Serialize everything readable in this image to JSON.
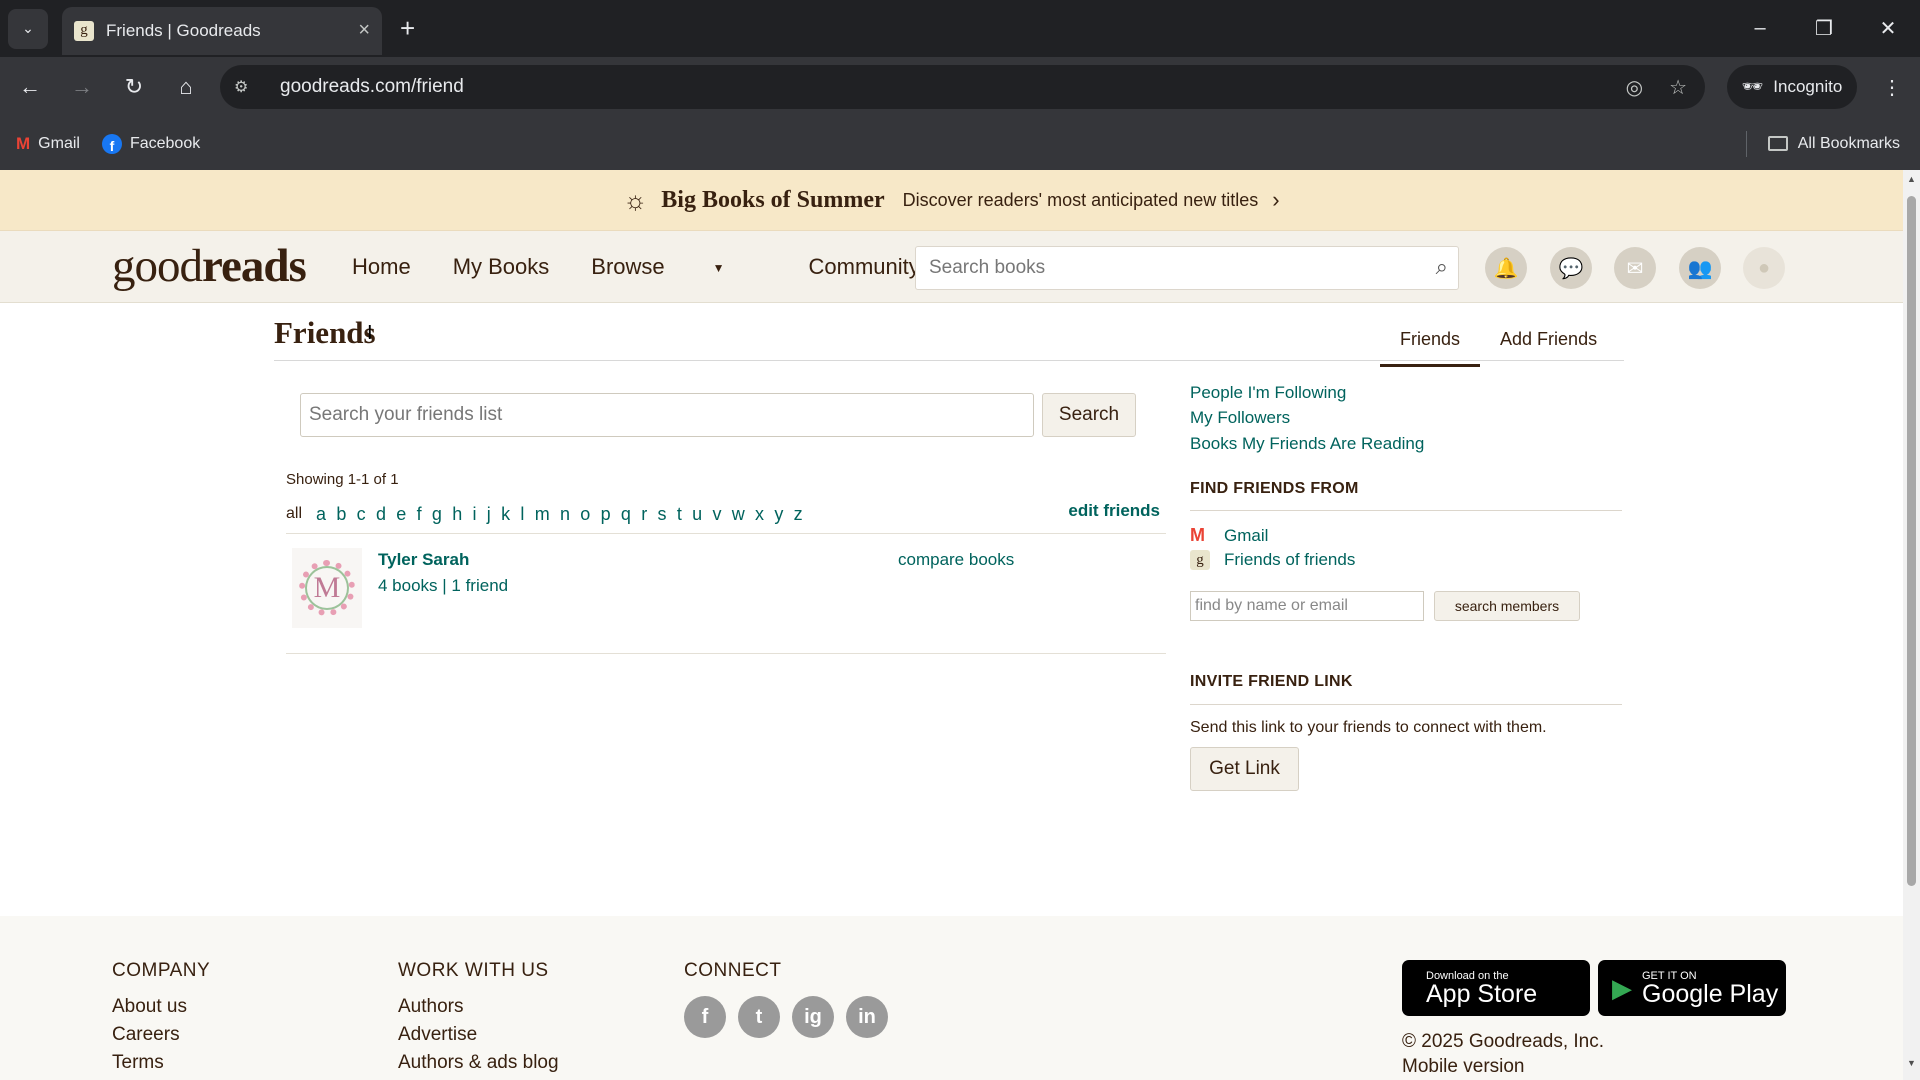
{
  "browser": {
    "tab_title": "Friends | Goodreads",
    "tab_favicon": "g",
    "url": "goodreads.com/friend",
    "incognito_label": "Incognito",
    "bookmarks": [
      {
        "label": "Gmail",
        "icon": "gmail-icon"
      },
      {
        "label": "Facebook",
        "icon": "facebook-icon"
      }
    ],
    "all_bookmarks_label": "All Bookmarks"
  },
  "promo": {
    "title": "Big Books of Summer",
    "text": "Discover readers' most anticipated new titles"
  },
  "header": {
    "logo_light": "good",
    "logo_bold": "reads",
    "nav": [
      "Home",
      "My Books",
      "Browse",
      "Community"
    ],
    "search_placeholder": "Search books"
  },
  "page": {
    "title": "Friends",
    "tabs": [
      "Friends",
      "Add Friends"
    ],
    "search_placeholder": "Search your friends list",
    "search_button": "Search",
    "showing": "Showing 1-1 of 1",
    "letters_all": "all",
    "letters": [
      "a",
      "b",
      "c",
      "d",
      "e",
      "f",
      "g",
      "h",
      "i",
      "j",
      "k",
      "l",
      "m",
      "n",
      "o",
      "p",
      "q",
      "r",
      "s",
      "t",
      "u",
      "v",
      "w",
      "x",
      "y",
      "z"
    ],
    "edit_friends": "edit friends",
    "friends": [
      {
        "name": "Tyler Sarah",
        "meta": "4 books | 1 friend",
        "compare": "compare books",
        "avatar_letter": "M"
      }
    ]
  },
  "sidebar": {
    "links": [
      "People I'm Following",
      "My Followers",
      "Books My Friends Are Reading"
    ],
    "find_heading": "FIND FRIENDS FROM",
    "sources": [
      "Gmail",
      "Friends of friends"
    ],
    "find_placeholder": "find by name or email",
    "find_button": "search members",
    "invite_heading": "INVITE FRIEND LINK",
    "invite_text": "Send this link to your friends to connect with them.",
    "get_link": "Get Link"
  },
  "footer": {
    "company_heading": "COMPANY",
    "company_links": [
      "About us",
      "Careers",
      "Terms"
    ],
    "work_heading": "WORK WITH US",
    "work_links": [
      "Authors",
      "Advertise",
      "Authors & ads blog"
    ],
    "connect_heading": "CONNECT",
    "social": [
      "f",
      "t",
      "ig",
      "in"
    ],
    "app_store_small": "Download on the",
    "app_store_large": "App Store",
    "play_small": "GET IT ON",
    "play_large": "Google Play",
    "copyright": "© 2025 Goodreads, Inc.",
    "mobile": "Mobile version"
  }
}
